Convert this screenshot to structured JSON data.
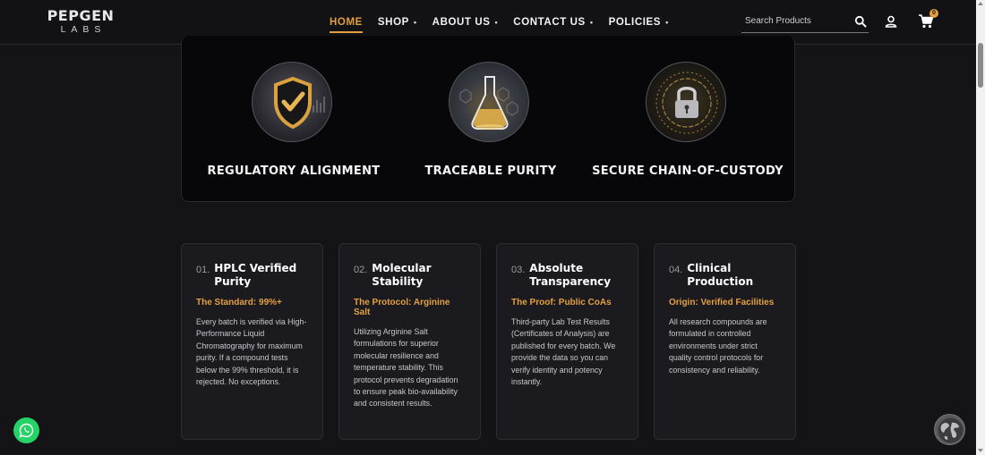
{
  "header": {
    "logo_top": "PEPGEN",
    "logo_bottom": "LABS",
    "nav": [
      {
        "label": "HOME",
        "active": true,
        "dropdown": false
      },
      {
        "label": "SHOP",
        "active": false,
        "dropdown": true
      },
      {
        "label": "ABOUT US",
        "active": false,
        "dropdown": true
      },
      {
        "label": "CONTACT US",
        "active": false,
        "dropdown": true
      },
      {
        "label": "POLICIES",
        "active": false,
        "dropdown": true
      }
    ],
    "dropdown_marker": "•",
    "search_placeholder": "Search Products",
    "cart_count": "0"
  },
  "features": [
    {
      "title": "REGULATORY ALIGNMENT",
      "icon": "shield-check-icon"
    },
    {
      "title": "TRACEABLE PURITY",
      "icon": "flask-icon"
    },
    {
      "title": "SECURE CHAIN-OF-CUSTODY",
      "icon": "padlock-icon"
    }
  ],
  "cards": [
    {
      "number": "01.",
      "title": "HPLC Verified Purity",
      "subtitle": "The Standard: 99%+",
      "body": "Every batch is verified via High-Performance Liquid Chromatography for maximum purity. If a compound tests below the 99% threshold, it is rejected. No exceptions."
    },
    {
      "number": "02.",
      "title": "Molecular Stability",
      "subtitle": "The Protocol: Arginine Salt",
      "body": "Utilizing Arginine Salt formulations for superior molecular resilience and temperature stability. This protocol prevents degradation to ensure peak bio-availability and consistent results."
    },
    {
      "number": "03.",
      "title": "Absolute Transparency",
      "subtitle": "The Proof: Public CoAs",
      "body": "Third-party Lab Test Results (Certificates of Analysis) are published for every batch. We provide the data so you can verify identity and potency instantly."
    },
    {
      "number": "04.",
      "title": "Clinical Production",
      "subtitle": "Origin: Verified Facilities",
      "body": "All research compounds are formulated in controlled environments under strict quality control protocols for consistency and reliability."
    }
  ],
  "colors": {
    "accent": "#e3a041",
    "background": "#141316",
    "card": "#1b1a1f",
    "whatsapp": "#25d366"
  }
}
